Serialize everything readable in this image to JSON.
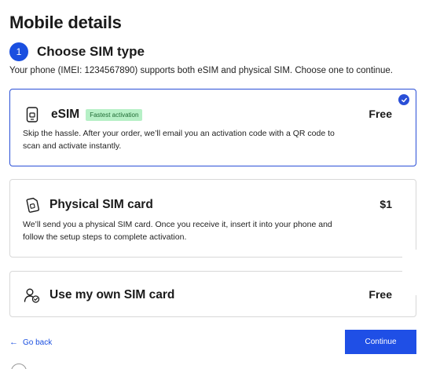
{
  "page": {
    "title": "Mobile details"
  },
  "step": {
    "number": "1",
    "title": "Choose SIM type"
  },
  "intro": "Your phone (IMEI: 1234567890) supports both eSIM and physical SIM. Choose one to continue.",
  "options": [
    {
      "name": "eSIM",
      "badge": "Fastest activation",
      "price": "Free",
      "description": "Skip the hassle. After your order, we’ll email you an activation code with a QR code to scan and activate instantly.",
      "icon": "phone-icon",
      "selected": true
    },
    {
      "name": "Physical SIM card",
      "price": "$1",
      "description": "We’ll send you a physical SIM card. Once you receive it, insert it into your phone and follow the setup steps to complete activation.",
      "icon": "sim-card-icon",
      "selected": false
    },
    {
      "name": "Use my own SIM card",
      "price": "Free",
      "icon": "user-check-icon",
      "selected": false
    }
  ],
  "nav": {
    "back_label": "Go back",
    "continue_label": "Continue"
  },
  "colors": {
    "accent": "#1f4fe6",
    "selected_border": "#2a4fd7",
    "badge_bg": "#b6f0c6",
    "badge_text": "#1f6b34"
  }
}
